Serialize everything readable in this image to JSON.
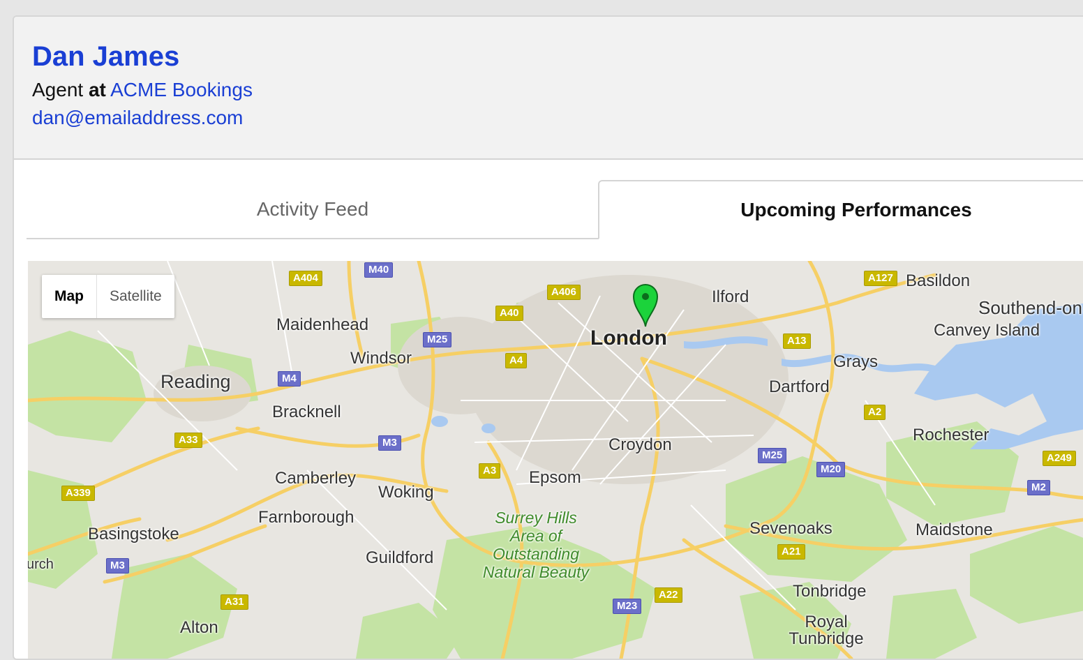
{
  "profile": {
    "name": "Dan James",
    "role_prefix": "Agent",
    "role_at": "at",
    "company": "ACME Bookings",
    "email": "dan@emailaddress.com"
  },
  "tabs": [
    {
      "label": "Activity Feed",
      "active": false
    },
    {
      "label": "Upcoming Performances",
      "active": true
    }
  ],
  "map": {
    "type_controls": {
      "map": "Map",
      "satellite": "Satellite"
    },
    "marker_city": "London",
    "places": [
      "Maidenhead",
      "Windsor",
      "Reading",
      "Bracknell",
      "Ilford",
      "Basildon",
      "Southend-on",
      "Canvey Island",
      "Grays",
      "Dartford",
      "Croydon",
      "Rochester",
      "Camberley",
      "Woking",
      "Epsom",
      "Farnborough",
      "Basingstoke",
      "Guildford",
      "Sevenoaks",
      "Maidstone",
      "Tonbridge",
      "Royal Tunbridge",
      "Alton",
      "urch"
    ],
    "park": [
      "Surrey Hills",
      "Area of",
      "Outstanding",
      "Natural Beauty"
    ],
    "roads": [
      "A404",
      "M40",
      "A406",
      "A40",
      "M25",
      "A4",
      "A127",
      "A13",
      "M4",
      "A33",
      "M3",
      "A3",
      "A2",
      "M25",
      "M20",
      "A249",
      "A339",
      "M2",
      "A21",
      "M3",
      "A31",
      "M23",
      "A22"
    ],
    "colors": {
      "water": "#a9c9f0",
      "park": "#c4e3a4",
      "road": "#f6cf65",
      "marker": "#1bd33b"
    }
  }
}
